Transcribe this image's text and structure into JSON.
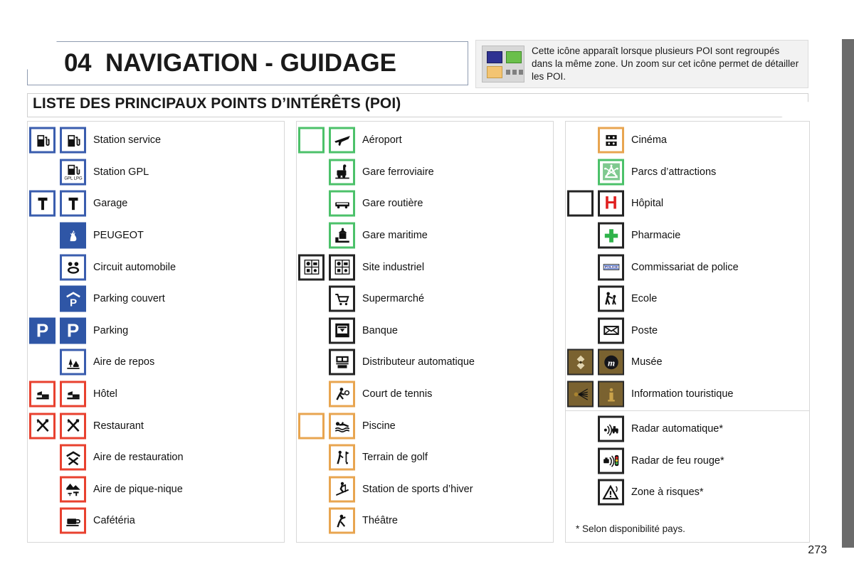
{
  "header": {
    "chapter_number": "04",
    "chapter_title": "NAVIGATION - GUIDAGE",
    "info_text": "Cette icône apparaît lorsque plusieurs POI sont regroupés dans la même zone. Un zoom sur cet icône permet de détailler les POI.",
    "cluster_icon_name": "poi-cluster-icon",
    "cluster_colors": {
      "blue": "#2e3192",
      "green": "#6abf4b",
      "orange": "#f3c472",
      "dots": "#808080",
      "panel": "#d8d8d8"
    }
  },
  "section": {
    "title": "LISTE DES PRINCIPAUX POINTS D’INTÉRÊTS (POI)"
  },
  "colors": {
    "frame_blue": "#3a5dae",
    "frame_red": "#e8412f",
    "frame_green": "#4cc16a",
    "frame_black": "#242424",
    "frame_orange": "#e8a550",
    "frame_brown": "#7a6230",
    "edge_bar": "#6b6b6b"
  },
  "columns": [
    {
      "id": "column-1",
      "rows": [
        {
          "label": "Station service",
          "icon": "fuel-pump-icon",
          "frame": "blue",
          "grouped": true
        },
        {
          "label": "Station GPL",
          "icon": "lpg-pump-icon",
          "frame": "blue",
          "grouped": false
        },
        {
          "label": "Garage",
          "icon": "wrench-icon",
          "frame": "blue",
          "grouped": true
        },
        {
          "label": "PEUGEOT",
          "icon": "peugeot-lion-icon",
          "frame": "bluefill",
          "grouped": false
        },
        {
          "label": "Circuit automobile",
          "icon": "race-circuit-icon",
          "frame": "blue",
          "grouped": false
        },
        {
          "label": "Parking couvert",
          "icon": "covered-parking-icon",
          "frame": "bluefill",
          "grouped": false
        },
        {
          "label": "Parking",
          "icon": "parking-icon",
          "frame": "bluefill",
          "grouped": true
        },
        {
          "label": "Aire de repos",
          "icon": "rest-area-icon",
          "frame": "blue",
          "grouped": false
        },
        {
          "label": "Hôtel",
          "icon": "bed-icon",
          "frame": "red",
          "grouped": true
        },
        {
          "label": "Restaurant",
          "icon": "cutlery-icon",
          "frame": "red",
          "grouped": true
        },
        {
          "label": "Aire de restauration",
          "icon": "food-area-icon",
          "frame": "red",
          "grouped": false
        },
        {
          "label": "Aire de pique-nique",
          "icon": "picnic-area-icon",
          "frame": "red",
          "grouped": false
        },
        {
          "label": "Cafétéria",
          "icon": "coffee-cup-icon",
          "frame": "red",
          "grouped": false
        }
      ]
    },
    {
      "id": "column-2",
      "rows": [
        {
          "label": "Aéroport",
          "icon": "airplane-icon",
          "frame": "green",
          "grouped": true
        },
        {
          "label": "Gare ferroviaire",
          "icon": "train-icon",
          "frame": "green",
          "grouped": false
        },
        {
          "label": "Gare routière",
          "icon": "bus-icon",
          "frame": "green",
          "grouped": false
        },
        {
          "label": "Gare maritime",
          "icon": "ferry-terminal-icon",
          "frame": "green",
          "grouped": false
        },
        {
          "label": "Site industriel",
          "icon": "industrial-site-icon",
          "frame": "black",
          "grouped": true
        },
        {
          "label": "Supermarché",
          "icon": "shopping-cart-icon",
          "frame": "black",
          "grouped": false
        },
        {
          "label": "Banque",
          "icon": "bank-icon",
          "frame": "black",
          "grouped": false
        },
        {
          "label": "Distributeur automatique",
          "icon": "atm-icon",
          "frame": "black",
          "grouped": false
        },
        {
          "label": "Court de tennis",
          "icon": "tennis-icon",
          "frame": "orange",
          "grouped": false
        },
        {
          "label": "Piscine",
          "icon": "swimmer-icon",
          "frame": "orange",
          "grouped": true
        },
        {
          "label": "Terrain de golf",
          "icon": "golf-icon",
          "frame": "orange",
          "grouped": false
        },
        {
          "label": "Station de sports d’hiver",
          "icon": "skier-icon",
          "frame": "orange",
          "grouped": false
        },
        {
          "label": "Théâtre",
          "icon": "theatre-icon",
          "frame": "orange",
          "grouped": false
        }
      ]
    },
    {
      "id": "column-3",
      "rows": [
        {
          "label": "Cinéma",
          "icon": "film-projector-icon",
          "frame": "orange",
          "grouped": false
        },
        {
          "label": "Parcs d’attractions",
          "icon": "theme-park-icon",
          "frame": "green",
          "grouped": false
        },
        {
          "label": "Hôpital",
          "icon": "hospital-h-icon",
          "frame": "black",
          "grouped": true
        },
        {
          "label": "Pharmacie",
          "icon": "pharmacy-cross-icon",
          "frame": "black",
          "grouped": false
        },
        {
          "label": "Commissariat de police",
          "icon": "police-icon",
          "frame": "black",
          "grouped": false
        },
        {
          "label": "Ecole",
          "icon": "school-icon",
          "frame": "black",
          "grouped": false
        },
        {
          "label": "Poste",
          "icon": "envelope-icon",
          "frame": "black",
          "grouped": false
        },
        {
          "label": "Musée",
          "icon": "museum-m-icon",
          "frame": "brown",
          "grouped": true
        },
        {
          "label": "Information touristique",
          "icon": "tourist-info-icon",
          "frame": "brown",
          "grouped": true
        }
      ],
      "rows_secondary": [
        {
          "label": "Radar automatique*",
          "icon": "speed-camera-icon",
          "frame": "black",
          "grouped": false
        },
        {
          "label": "Radar de feu rouge*",
          "icon": "red-light-radar-icon",
          "frame": "black",
          "grouped": false
        },
        {
          "label": "Zone à risques*",
          "icon": "risk-zone-icon",
          "frame": "black",
          "grouped": false
        }
      ],
      "footnote": "* Selon disponibilité pays."
    }
  ],
  "footer": {
    "page_number": "273"
  }
}
